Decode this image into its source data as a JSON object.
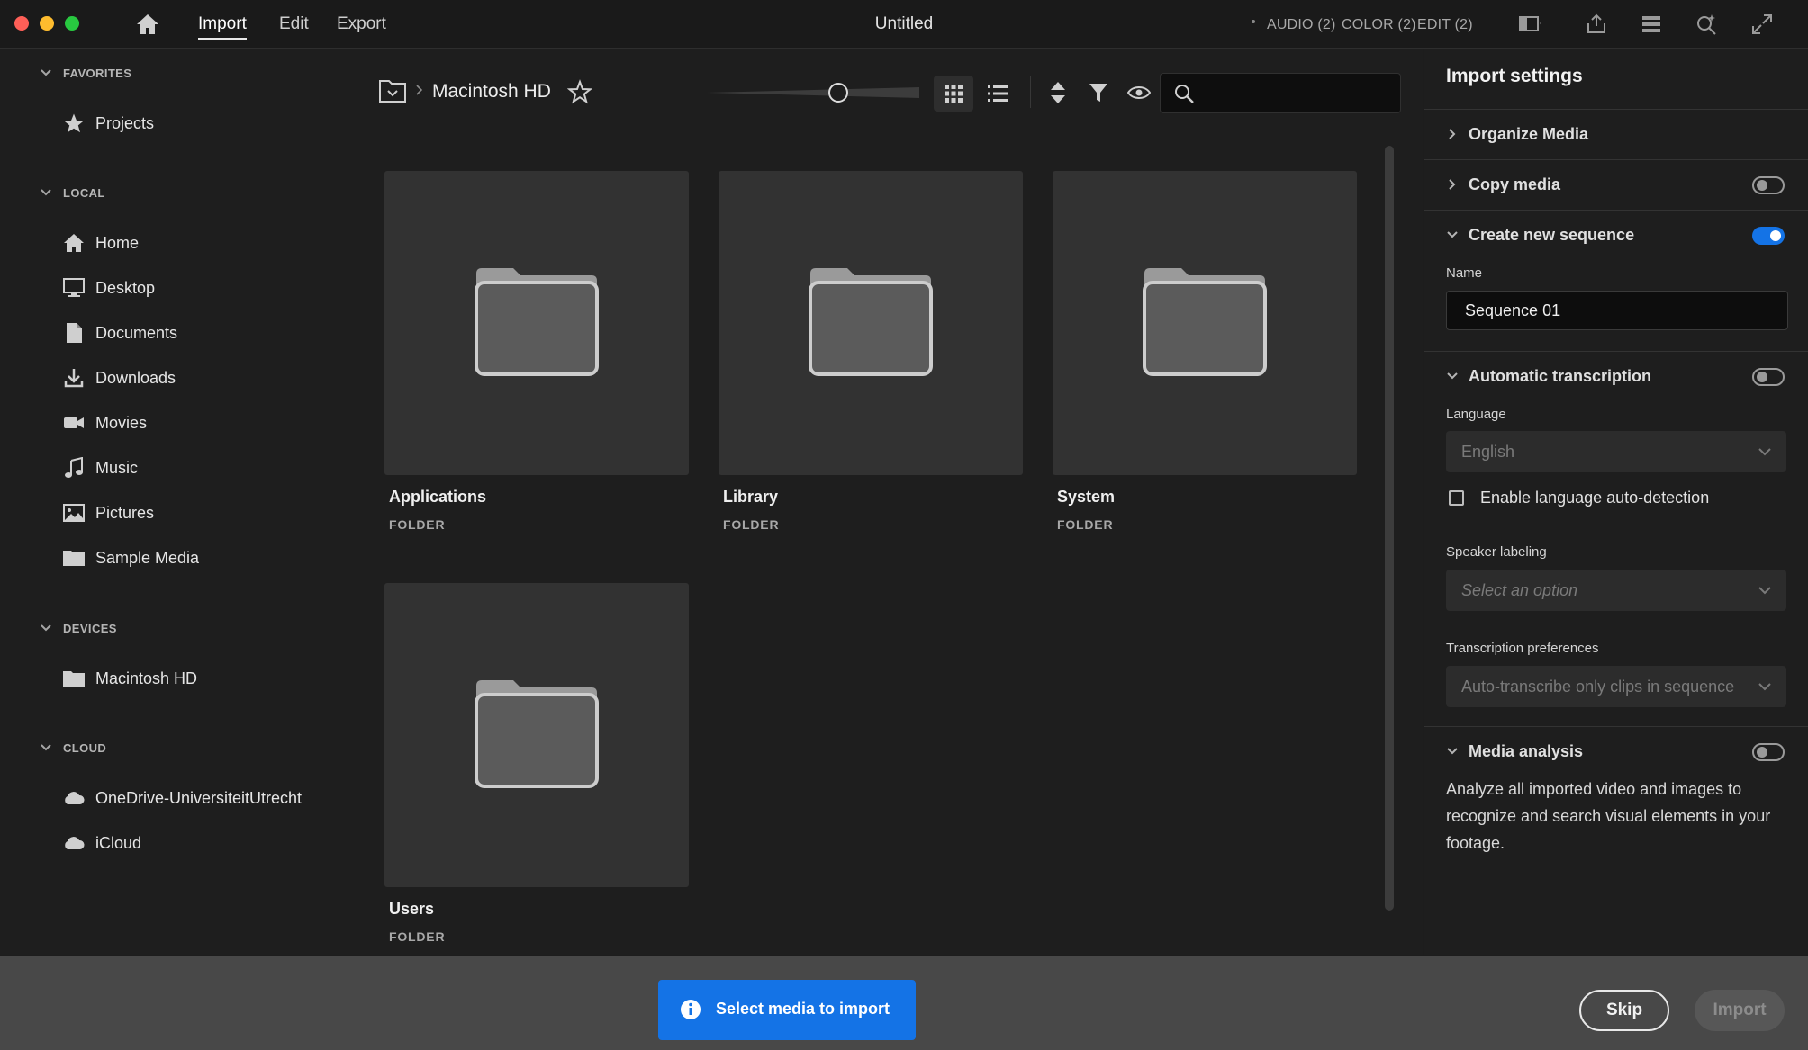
{
  "window": {
    "title": "Untitled"
  },
  "menu": {
    "import": "Import",
    "edit": "Edit",
    "export": "Export"
  },
  "workspaces": {
    "audio": "AUDIO (2)",
    "color": "COLOR (2)",
    "edit": "EDIT (2)"
  },
  "sidebar": {
    "favorites": {
      "header": "FAVORITES",
      "items": [
        {
          "label": "Projects",
          "icon": "star-icon"
        }
      ]
    },
    "local": {
      "header": "LOCAL",
      "items": [
        {
          "label": "Home",
          "icon": "home-icon"
        },
        {
          "label": "Desktop",
          "icon": "desktop-icon"
        },
        {
          "label": "Documents",
          "icon": "document-icon"
        },
        {
          "label": "Downloads",
          "icon": "download-icon"
        },
        {
          "label": "Movies",
          "icon": "video-camera-icon"
        },
        {
          "label": "Music",
          "icon": "music-note-icon"
        },
        {
          "label": "Pictures",
          "icon": "image-icon"
        },
        {
          "label": "Sample Media",
          "icon": "folder-icon"
        }
      ]
    },
    "devices": {
      "header": "DEVICES",
      "items": [
        {
          "label": "Macintosh HD",
          "icon": "folder-icon"
        }
      ]
    },
    "cloud": {
      "header": "CLOUD",
      "items": [
        {
          "label": "OneDrive-UniversiteitUtrecht",
          "icon": "cloud-icon"
        },
        {
          "label": "iCloud",
          "icon": "cloud-icon"
        }
      ]
    }
  },
  "browser": {
    "breadcrumb": "Macintosh HD",
    "search": {
      "value": "",
      "placeholder": ""
    },
    "tiles": [
      {
        "name": "Applications",
        "type": "FOLDER"
      },
      {
        "name": "Library",
        "type": "FOLDER"
      },
      {
        "name": "System",
        "type": "FOLDER"
      },
      {
        "name": "Users",
        "type": "FOLDER"
      }
    ]
  },
  "import_settings": {
    "title": "Import settings",
    "organize_media": "Organize Media",
    "copy_media": "Copy media",
    "create_sequence": "Create new sequence",
    "name_label": "Name",
    "name_value": "Sequence 01",
    "auto_transcription": "Automatic transcription",
    "language_label": "Language",
    "language_value": "English",
    "auto_detect_label": "Enable language auto-detection",
    "speaker_label": "Speaker labeling",
    "speaker_placeholder": "Select an option",
    "transcription_prefs_label": "Transcription preferences",
    "transcription_prefs_value": "Auto-transcribe only clips in sequence",
    "media_analysis": "Media analysis",
    "media_analysis_desc": "Analyze all imported video and images to recognize and search visual elements in your footage.",
    "toggles": {
      "copy_media": false,
      "create_sequence": true,
      "auto_transcription": false,
      "media_analysis": false
    }
  },
  "bottom": {
    "toast": "Select media to import",
    "skip": "Skip",
    "import": "Import"
  },
  "colors": {
    "accent": "#1473e6",
    "background": "#1e1e1e",
    "tile": "#323232"
  }
}
